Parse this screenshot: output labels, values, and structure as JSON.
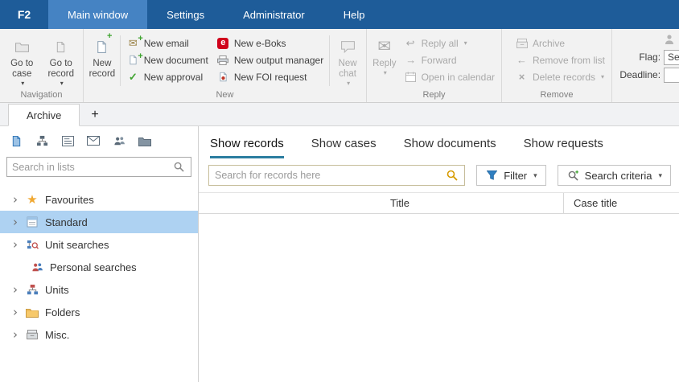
{
  "colors": {
    "titlebar": "#1e5c99",
    "titlebar_active_tab": "#4583c3",
    "selection_blue": "#aed2f2",
    "tab_underline": "#2b7da0",
    "green_accent": "#3ea32e",
    "eboks_red": "#d0021b",
    "gold_search": "#d79b00",
    "filter_blue": "#2f7fc1"
  },
  "titlebar": {
    "logo": "F2",
    "tabs": [
      {
        "label": "Main window",
        "active": true
      },
      {
        "label": "Settings",
        "active": false
      },
      {
        "label": "Administrator",
        "active": false
      },
      {
        "label": "Help",
        "active": false
      }
    ]
  },
  "ribbon": {
    "group_labels": {
      "navigation": "Navigation",
      "new": "New",
      "reply": "Reply",
      "remove": "Remove"
    },
    "navigation": {
      "go_to_case": "Go to case",
      "go_to_record": "Go to record"
    },
    "new": {
      "new_record": "New record",
      "new_email": "New email",
      "new_document": "New document",
      "new_approval": "New approval",
      "new_eboks": "New e-Boks",
      "new_output_manager": "New output manager",
      "new_foi": "New FOI request",
      "new_chat": "New chat"
    },
    "reply": {
      "reply": "Reply",
      "reply_all": "Reply all",
      "forward": "Forward",
      "open_in_calendar": "Open in calendar"
    },
    "remove": {
      "archive": "Archive",
      "remove_from_list": "Remove from list",
      "delete_records": "Delete records"
    },
    "flag": {
      "flag_label": "Flag:",
      "deadline_label": "Deadline:",
      "flag_value": "Se"
    }
  },
  "workspace": {
    "tab": "Archive",
    "add": "+"
  },
  "sidebar": {
    "search_placeholder": "Search in lists",
    "tree": [
      {
        "label": "Favourites"
      },
      {
        "label": "Standard"
      },
      {
        "label": "Unit searches"
      },
      {
        "label": "Personal searches"
      },
      {
        "label": "Units"
      },
      {
        "label": "Folders"
      },
      {
        "label": "Misc."
      }
    ]
  },
  "main": {
    "view_tabs": [
      {
        "label": "Show records",
        "active": true
      },
      {
        "label": "Show cases",
        "active": false
      },
      {
        "label": "Show documents",
        "active": false
      },
      {
        "label": "Show requests",
        "active": false
      }
    ],
    "search_placeholder": "Search for records here",
    "filter_label": "Filter",
    "search_criteria_label": "Search criteria",
    "table": {
      "columns": [
        "Title",
        "Case title"
      ],
      "rows": []
    }
  },
  "icons": {
    "caret": "▾",
    "chevron": "›",
    "star": "★",
    "envelope": "✉",
    "plus": "+",
    "check": "✓",
    "arrow_left": "←",
    "reply_arrow": "↩",
    "cross": "×",
    "eboks_letter": "e"
  }
}
